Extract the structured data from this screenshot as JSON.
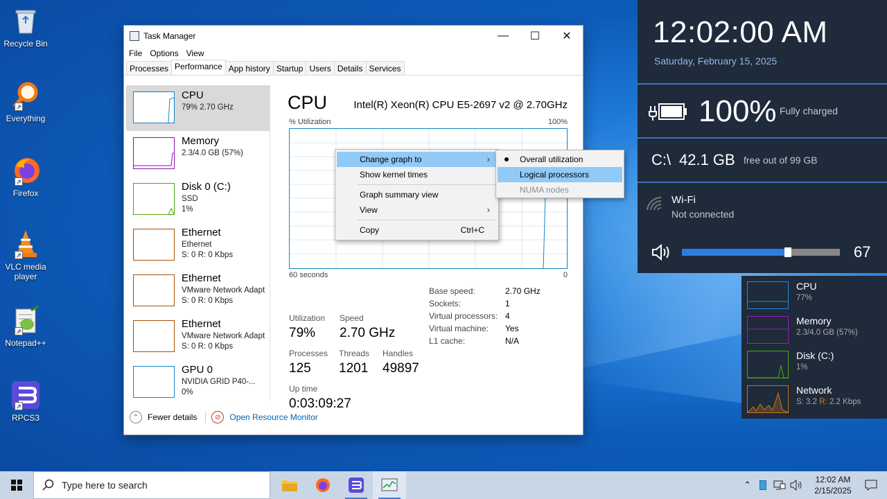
{
  "desktop": {
    "icons": [
      {
        "label": "Recycle Bin"
      },
      {
        "label": "Everything"
      },
      {
        "label": "Firefox"
      },
      {
        "label": "VLC media player"
      },
      {
        "label": "Notepad++"
      },
      {
        "label": "RPCS3"
      }
    ]
  },
  "task_manager": {
    "title": "Task Manager",
    "menu": [
      "File",
      "Options",
      "View"
    ],
    "tabs": [
      "Processes",
      "Performance",
      "App history",
      "Startup",
      "Users",
      "Details",
      "Services"
    ],
    "active_tab": "Performance",
    "sidebar": [
      {
        "name": "CPU",
        "l1": "79% 2.70 GHz",
        "l2": "",
        "l3": "",
        "color": "#1183c9"
      },
      {
        "name": "Memory",
        "l1": "2.3/4.0 GB (57%)",
        "l2": "",
        "l3": "",
        "color": "#8b12ae"
      },
      {
        "name": "Disk 0 (C:)",
        "l1": "SSD",
        "l2": "1%",
        "l3": "",
        "color": "#4da60c"
      },
      {
        "name": "Ethernet",
        "l1": "Ethernet",
        "l2": "S: 0 R: 0 Kbps",
        "l3": "",
        "color": "#a74f01"
      },
      {
        "name": "Ethernet",
        "l1": "VMware Network Adapt",
        "l2": "S: 0 R: 0 Kbps",
        "l3": "",
        "color": "#a74f01"
      },
      {
        "name": "Ethernet",
        "l1": "VMware Network Adapt",
        "l2": "S: 0 R: 0 Kbps",
        "l3": "",
        "color": "#a74f01"
      },
      {
        "name": "GPU 0",
        "l1": "NVIDIA GRID P40-...",
        "l2": "0%",
        "l3": "",
        "color": "#1183c9"
      }
    ],
    "main": {
      "heading": "CPU",
      "model": "Intel(R) Xeon(R) CPU E5-2697 v2 @ 2.70GHz",
      "util_label": "% Utilization",
      "util_max": "100%",
      "axis_left": "60 seconds",
      "axis_right": "0",
      "stats": {
        "utilization_label": "Utilization",
        "utilization": "79%",
        "speed_label": "Speed",
        "speed": "2.70 GHz",
        "processes_label": "Processes",
        "processes": "125",
        "threads_label": "Threads",
        "threads": "1201",
        "handles_label": "Handles",
        "handles": "49897",
        "uptime_label": "Up time",
        "uptime": "0:03:09:27"
      },
      "info": [
        {
          "k": "Base speed:",
          "v": "2.70 GHz"
        },
        {
          "k": "Sockets:",
          "v": "1"
        },
        {
          "k": "Virtual processors:",
          "v": "4"
        },
        {
          "k": "Virtual machine:",
          "v": "Yes"
        },
        {
          "k": "L1 cache:",
          "v": "N/A"
        }
      ]
    },
    "footer": {
      "fewer": "Fewer details",
      "monitor": "Open Resource Monitor"
    }
  },
  "context_menu": {
    "items": [
      "Change graph to",
      "Show kernel times",
      "Graph summary view",
      "View",
      "Copy"
    ],
    "copy_shortcut": "Ctrl+C",
    "submenu": [
      "Overall utilization",
      "Logical processors",
      "NUMA nodes"
    ]
  },
  "flyout": {
    "time": "12:02:00 AM",
    "date": "Saturday, February 15, 2025",
    "battery_pct": "100%",
    "battery_status": "Fully charged",
    "drive": "C:\\",
    "drive_free": "42.1 GB",
    "drive_total": "free out of 99 GB",
    "wifi_name": "Wi-Fi",
    "wifi_status": "Not connected",
    "volume": "67",
    "volume_level": 0.67
  },
  "mini_monitor": [
    {
      "name": "CPU",
      "value": "77%",
      "color": "#1b8fd6"
    },
    {
      "name": "Memory",
      "value": "2.3/4.0 GB (57%)",
      "color": "#9b1fbf"
    },
    {
      "name": "Disk (C:)",
      "value": "1%",
      "color": "#4da60c"
    },
    {
      "name": "Network",
      "value_s": "S: 3.2 ",
      "value_r": "R:",
      "value_r2": " 2.2 Kbps",
      "color": "#c8741a"
    }
  ],
  "taskbar": {
    "search_placeholder": "Type here to search",
    "time": "12:02 AM",
    "date": "2/15/2025"
  }
}
